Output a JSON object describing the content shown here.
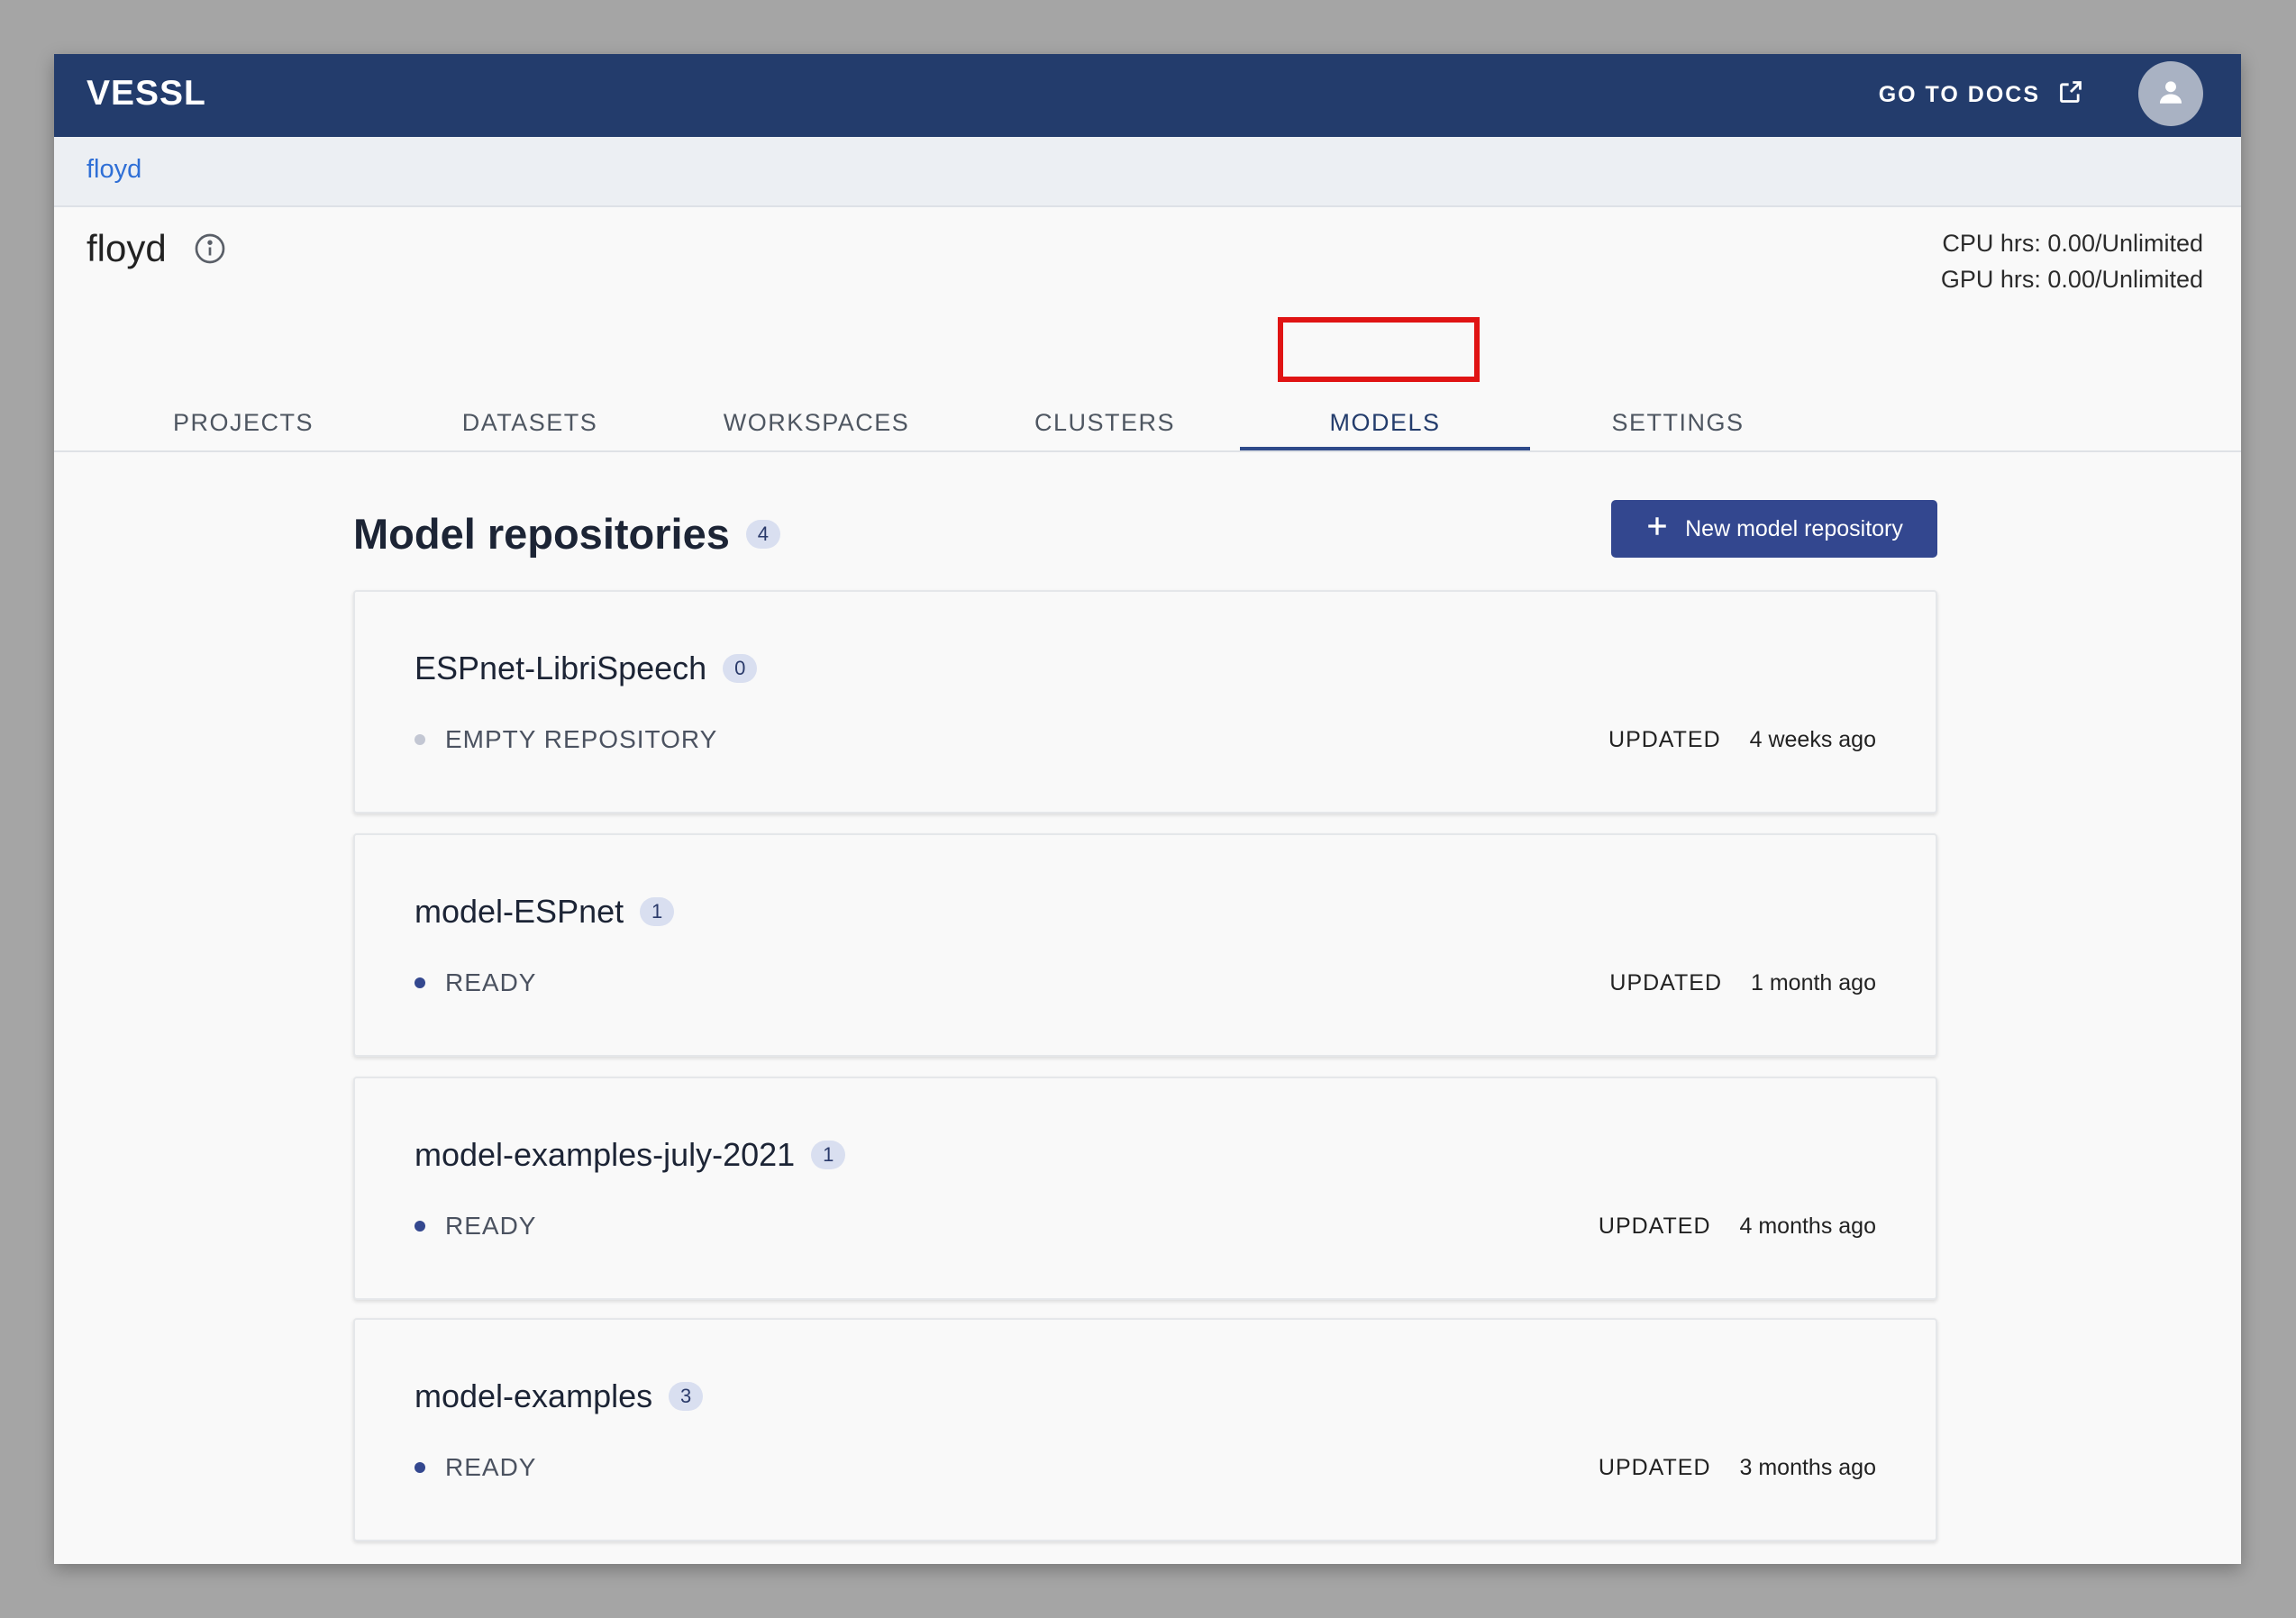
{
  "topbar": {
    "logo": "VESSL",
    "docs_label": "GO TO DOCS",
    "docs_icon": "external-link-icon",
    "avatar_icon": "user-icon"
  },
  "breadcrumb": {
    "org": "floyd"
  },
  "org": {
    "name": "floyd",
    "info_icon": "info-icon",
    "cpu_usage": "CPU hrs: 0.00/Unlimited",
    "gpu_usage": "GPU hrs: 0.00/Unlimited"
  },
  "tabs": [
    {
      "label": "PROJECTS"
    },
    {
      "label": "DATASETS"
    },
    {
      "label": "WORKSPACES"
    },
    {
      "label": "CLUSTERS"
    },
    {
      "label": "MODELS",
      "active": true
    },
    {
      "label": "SETTINGS"
    }
  ],
  "section": {
    "title": "Model repositories",
    "count": "4",
    "new_button_label": "New model repository",
    "new_button_icon": "plus-icon"
  },
  "repositories": [
    {
      "name": "ESPnet-LibriSpeech",
      "count": "0",
      "status": "EMPTY REPOSITORY",
      "updated_label": "UPDATED",
      "updated": "4 weeks ago"
    },
    {
      "name": "model-ESPnet",
      "count": "1",
      "status": "READY",
      "updated_label": "UPDATED",
      "updated": "1 month ago"
    },
    {
      "name": "model-examples-july-2021",
      "count": "1",
      "status": "READY",
      "updated_label": "UPDATED",
      "updated": "4 months ago"
    },
    {
      "name": "model-examples",
      "count": "3",
      "status": "READY",
      "updated_label": "UPDATED",
      "updated": "3 months ago"
    }
  ],
  "colors": {
    "header_bg": "#233c6c",
    "accent": "#33478f",
    "highlight": "#e01414",
    "status_ready": "#34488f",
    "status_empty": "#c3c7d3"
  }
}
